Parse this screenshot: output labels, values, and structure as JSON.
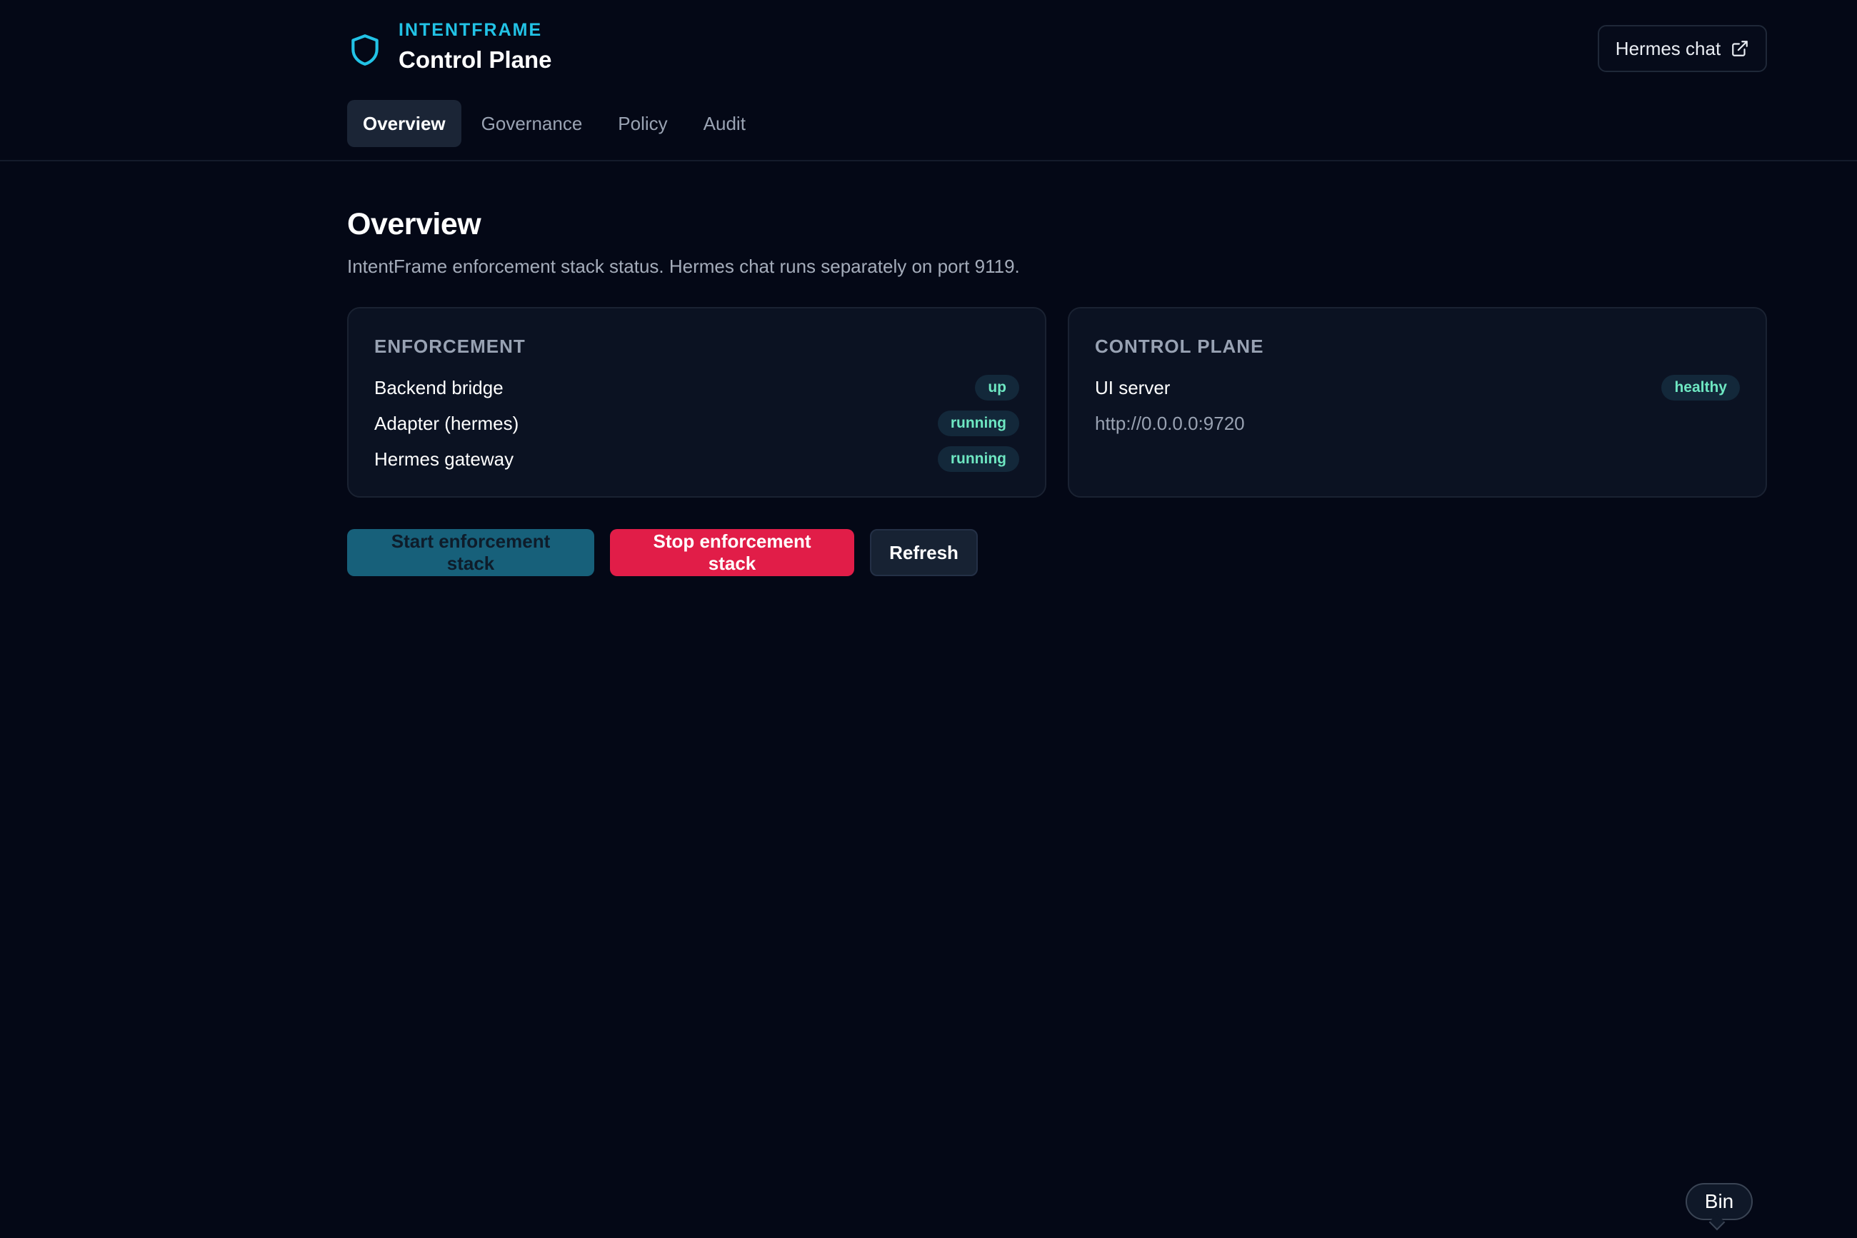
{
  "header": {
    "brand_kicker": "INTENTFRAME",
    "brand_title": "Control Plane",
    "brand_icon": "shield-icon",
    "external_link": {
      "label": "Hermes chat",
      "icon": "external-link-icon"
    }
  },
  "nav": {
    "tabs": [
      {
        "label": "Overview",
        "active": true
      },
      {
        "label": "Governance",
        "active": false
      },
      {
        "label": "Policy",
        "active": false
      },
      {
        "label": "Audit",
        "active": false
      }
    ]
  },
  "main": {
    "title": "Overview",
    "subtitle": "IntentFrame enforcement stack status. Hermes chat runs separately on port 9119."
  },
  "cards": {
    "enforcement": {
      "title": "ENFORCEMENT",
      "rows": [
        {
          "label": "Backend bridge",
          "status": "up"
        },
        {
          "label": "Adapter (hermes)",
          "status": "running"
        },
        {
          "label": "Hermes gateway",
          "status": "running"
        }
      ]
    },
    "control_plane": {
      "title": "CONTROL PLANE",
      "rows": [
        {
          "label": "UI server",
          "status": "healthy"
        }
      ],
      "url": "http://0.0.0.0:9720"
    }
  },
  "actions": {
    "start_label": "Start enforcement stack",
    "stop_label": "Stop enforcement stack",
    "refresh_label": "Refresh"
  },
  "bubble": {
    "label": "Bin"
  },
  "colors": {
    "background": "#040816",
    "accent": "#22c3e6",
    "status_text": "#6ee7c2",
    "danger": "#e11d48",
    "start_button": "#17607a"
  }
}
